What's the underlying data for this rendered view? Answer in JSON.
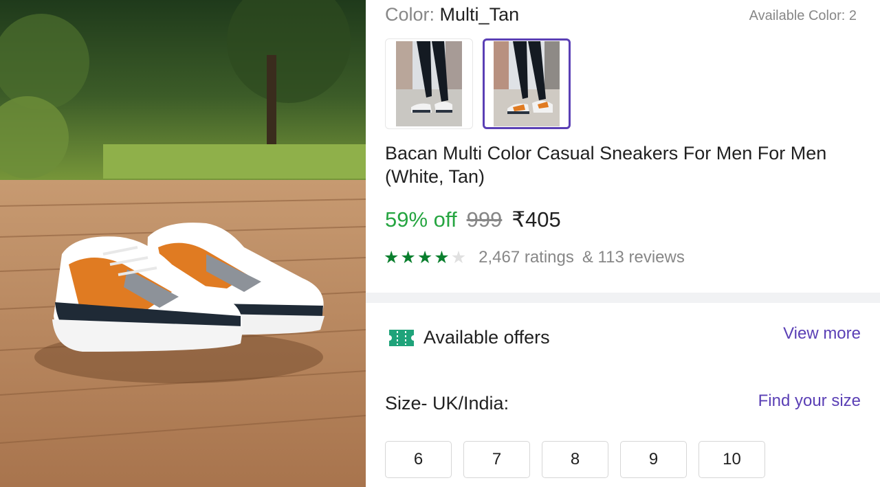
{
  "product": {
    "color_label": "Color:",
    "color_value": "Multi_Tan",
    "available_colors": "Available Color: 2",
    "title": "Bacan Multi Color Casual Sneakers For Men For Men (White, Tan)",
    "discount": "59% off",
    "mrp": "999",
    "price": "₹405",
    "rating_value": 4,
    "rating_max": 5,
    "ratings_count": "2,467 ratings",
    "reviews_count": "& 113 reviews"
  },
  "variants": [
    {
      "name": "white-grey",
      "selected": false
    },
    {
      "name": "multi-tan",
      "selected": true
    }
  ],
  "offers": {
    "title": "Available offers",
    "link": "View more",
    "icon": "offer-ticket-icon",
    "icon_color": "#1fa37a"
  },
  "size": {
    "label": "Size- UK/India:",
    "link": "Find your size",
    "options": [
      "6",
      "7",
      "8",
      "9",
      "10"
    ]
  },
  "colors": {
    "discount": "#26a541",
    "accent": "#5a3fb5",
    "star": "#0a7f2e"
  }
}
